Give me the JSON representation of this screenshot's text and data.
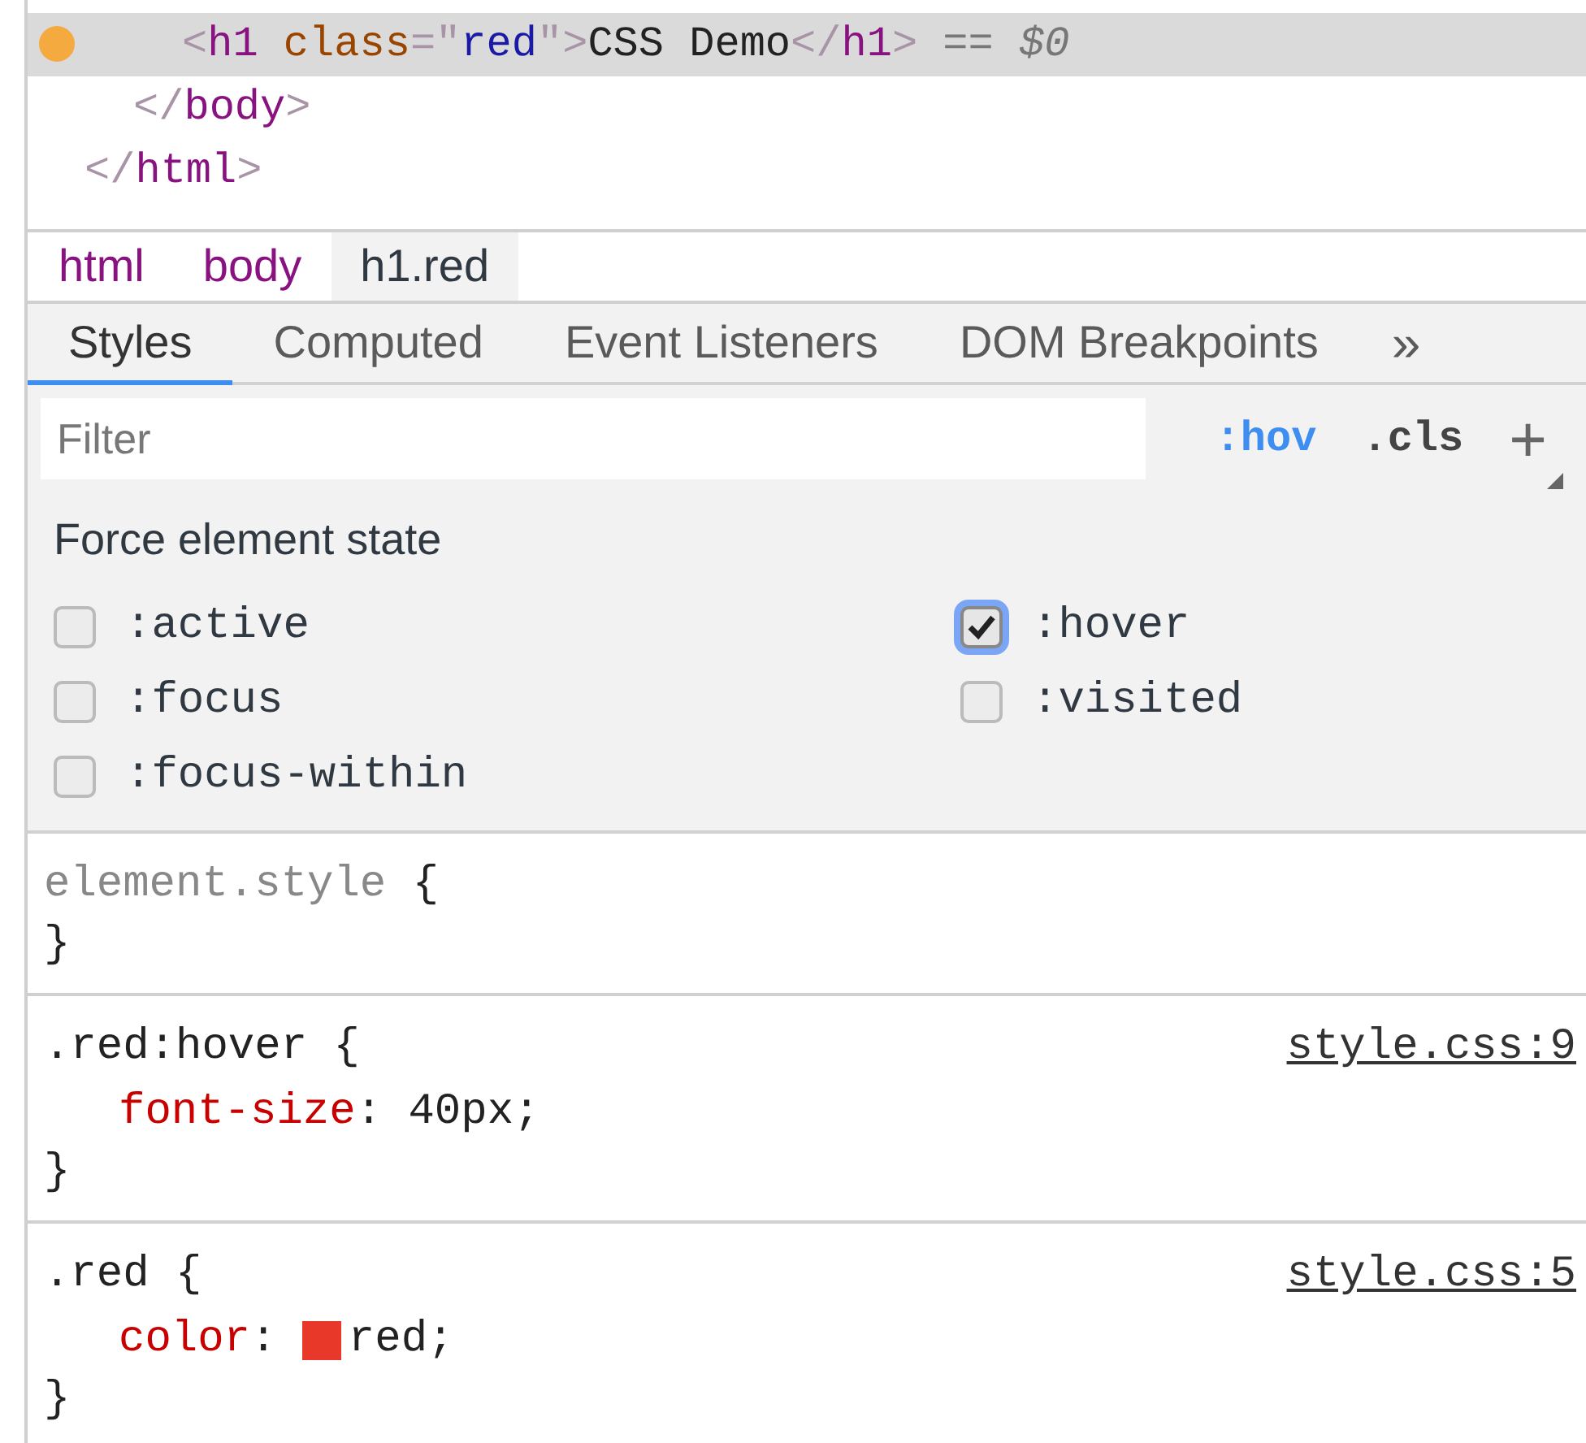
{
  "dom_tree": {
    "closing": [
      {
        "kind": "bracket",
        "text": "</"
      },
      {
        "kind": "tag",
        "text": "html"
      },
      {
        "kind": "bracket",
        "text": ">"
      }
    ],
    "children": [
      {
        "closing": [
          {
            "kind": "bracket",
            "text": "</"
          },
          {
            "kind": "tag",
            "text": "body"
          },
          {
            "kind": "bracket",
            "text": ">"
          }
        ],
        "children": [
          {
            "selected": true,
            "breakpoint": true,
            "tokens": [
              {
                "kind": "bracket",
                "text": "<"
              },
              {
                "kind": "tag",
                "text": "h1"
              },
              {
                "kind": "attr",
                "text": " class"
              },
              {
                "kind": "bracket",
                "text": "=\""
              },
              {
                "kind": "value",
                "text": "red"
              },
              {
                "kind": "bracket",
                "text": "\">"
              },
              {
                "kind": "text",
                "text": "CSS Demo"
              },
              {
                "kind": "bracket",
                "text": "</"
              },
              {
                "kind": "tag",
                "text": "h1"
              },
              {
                "kind": "bracket",
                "text": ">"
              },
              {
                "kind": "hint",
                "text": " == *$0*"
              }
            ]
          }
        ]
      }
    ]
  },
  "breadcrumbs": [
    {
      "label": "html",
      "selected": false
    },
    {
      "label": "body",
      "selected": false
    },
    {
      "label": "h1.red",
      "selected": true
    }
  ],
  "tabs": [
    {
      "label": "Styles",
      "selected": true
    },
    {
      "label": "Computed",
      "selected": false
    },
    {
      "label": "Event Listeners",
      "selected": false
    },
    {
      "label": "DOM Breakpoints",
      "selected": false
    }
  ],
  "tabs_overflow": "»",
  "filter": {
    "placeholder": "Filter"
  },
  "toolbar_toggles": [
    {
      "label": ":hov",
      "active": true
    },
    {
      "label": ".cls",
      "active": false
    }
  ],
  "add_rule": "+",
  "force_state": {
    "title": "Force element state",
    "states": [
      {
        "label": ":active",
        "checked": false
      },
      {
        "label": ":hover",
        "checked": true
      },
      {
        "label": ":focus",
        "checked": false
      },
      {
        "label": ":visited",
        "checked": false
      },
      {
        "label": ":focus-within",
        "checked": false
      }
    ]
  },
  "rules": [
    {
      "kind": "inline",
      "selector": "element.style",
      "open": " {",
      "close": "}"
    },
    {
      "kind": "stylesheet",
      "selector": ".red:hover",
      "open": " {",
      "close": "}",
      "source": "style.css:9",
      "declarations": [
        {
          "property": "font-size",
          "colon": ": ",
          "value": "40px;"
        }
      ]
    },
    {
      "kind": "stylesheet",
      "selector": ".red",
      "open": " {",
      "close": "}",
      "source": "style.css:5",
      "declarations": [
        {
          "property": "color",
          "colon": ": ",
          "value": "red;",
          "color": "#e8382a"
        }
      ]
    }
  ]
}
